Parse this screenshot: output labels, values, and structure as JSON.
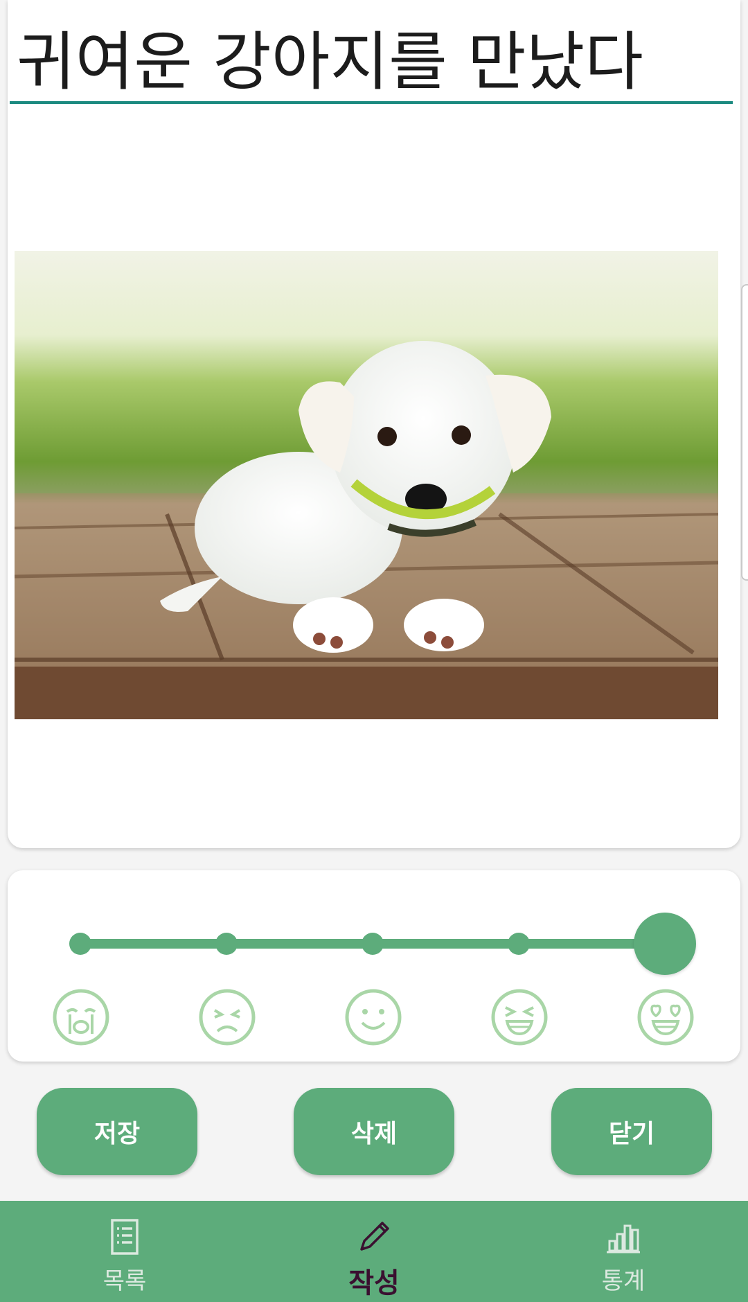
{
  "entry": {
    "title": "귀여운 강아지를 만났다"
  },
  "mood": {
    "levels": [
      "crying",
      "sad",
      "smile",
      "laughing",
      "love"
    ],
    "selected_index": 4,
    "faces": {
      "crying": "crying-face-icon",
      "sad": "sad-face-icon",
      "smile": "smile-face-icon",
      "laughing": "laughing-face-icon",
      "love": "heart-eyes-face-icon"
    }
  },
  "actions": {
    "save_label": "저장",
    "delete_label": "삭제",
    "close_label": "닫기"
  },
  "nav": {
    "items": [
      {
        "label": "목록",
        "icon": "list-icon",
        "active": false
      },
      {
        "label": "작성",
        "icon": "pencil-icon",
        "active": true
      },
      {
        "label": "통계",
        "icon": "bar-chart-icon",
        "active": false
      }
    ]
  },
  "colors": {
    "accent": "#5dac7b",
    "title_underline": "#1b8a80",
    "face_stroke": "#a9d6a7",
    "active_nav_text": "#3a1030"
  }
}
